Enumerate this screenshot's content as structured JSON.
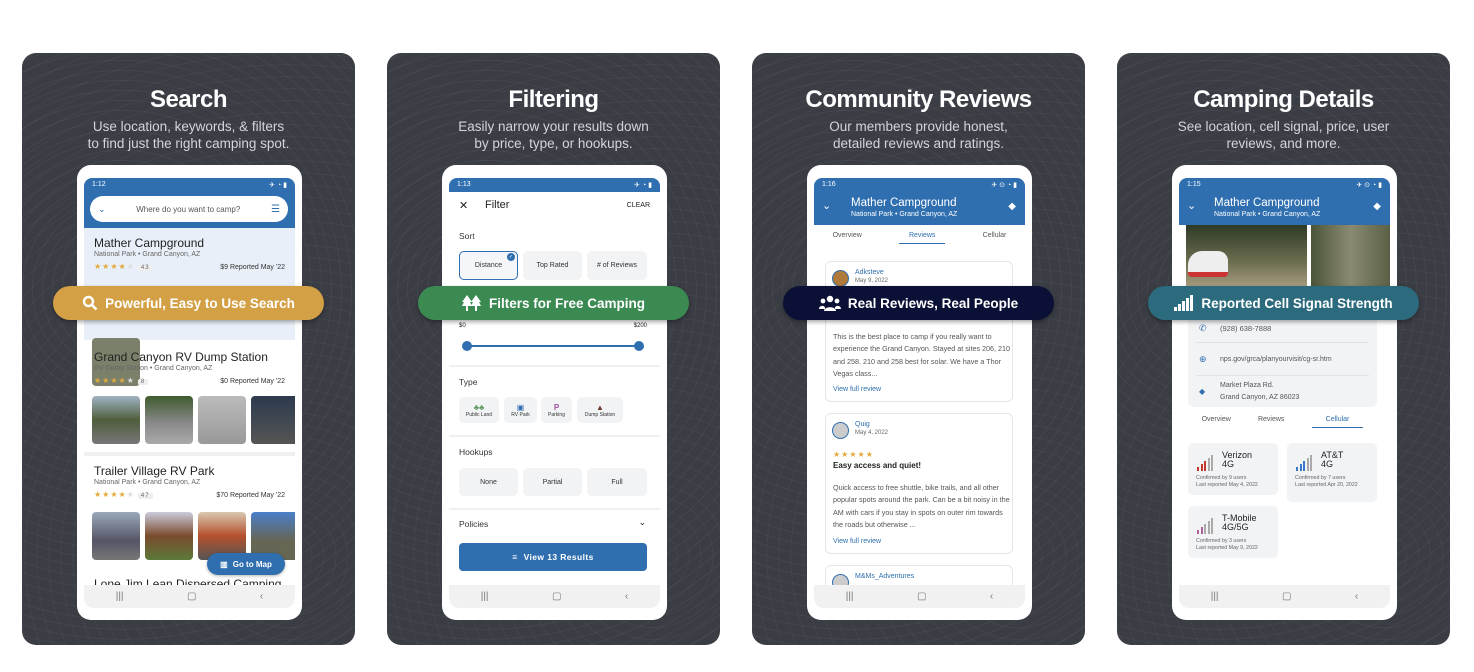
{
  "colors": {
    "panel_bg": "#3b3d45",
    "app_blue": "#2f6fb0",
    "search_banner": "#d4a046",
    "filter_banner": "#3b8a52",
    "reviews_banner": "#0b1136",
    "cell_banner": "#2c6b7d"
  },
  "panels": [
    {
      "title": "Search",
      "subtitle_lines": [
        "Use location, keywords, & filters",
        "to find just the right camping spot."
      ],
      "banner": {
        "label": "Powerful, Easy to Use Search",
        "icon": "search-icon"
      }
    },
    {
      "title": "Filtering",
      "subtitle_lines": [
        "Easily narrow your results down",
        "by price,  type, or hookups."
      ],
      "banner": {
        "label": "Filters for Free Camping",
        "icon": "trees-icon"
      }
    },
    {
      "title": "Community Reviews",
      "subtitle_lines": [
        "Our members provide honest,",
        "detailed reviews and ratings."
      ],
      "banner": {
        "label": "Real Reviews, Real People",
        "icon": "people-icon"
      }
    },
    {
      "title": "Camping Details",
      "subtitle_lines": [
        "See location, cell signal, price, user",
        "reviews, and more."
      ],
      "banner": {
        "label": "Reported Cell Signal Strength",
        "icon": "signal-icon"
      }
    }
  ],
  "search": {
    "time": "1:12",
    "placeholder": "Where do you want to camp?",
    "results": [
      {
        "name": "Mather Campground",
        "type": "National Park • Grand Canyon, AZ",
        "rating": 4,
        "reviews": "43",
        "price": "$9 Reported May '22"
      },
      {
        "name": "Grand Canyon RV Dump Station",
        "type": "RV Dump Station • Grand Canyon, AZ",
        "rating": 4,
        "reviews": "8",
        "price": "$0 Reported May '22"
      },
      {
        "name": "Trailer Village RV Park",
        "type": "National Park • Grand Canyon, AZ",
        "rating": 4,
        "reviews": "47",
        "price": "$70 Reported May '22"
      },
      {
        "name": "Lone Jim Lean Dispersed Camping"
      }
    ],
    "map_button": "Go to Map"
  },
  "filter": {
    "time": "1:13",
    "title": "Filter",
    "clear": "CLEAR",
    "sort_label": "Sort",
    "sort_options": [
      "Distance",
      "Top Rated",
      "# of Reviews"
    ],
    "sort_selected": "Distance",
    "price_min": "$0",
    "price_max": "$200",
    "type_label": "Type",
    "types": [
      "Public Land",
      "RV Park",
      "Parking",
      "Dump Station"
    ],
    "hookups_label": "Hookups",
    "hookups": [
      "None",
      "Partial",
      "Full"
    ],
    "policies_label": "Policies",
    "results_button": "View 13 Results"
  },
  "reviews": {
    "time": "1:16",
    "name": "Mather Campground",
    "subtitle": "National Park • Grand Canyon, AZ",
    "tabs": [
      "Overview",
      "Reviews",
      "Cellular"
    ],
    "active_tab": "Reviews",
    "items": [
      {
        "user": "Adksteve",
        "date": "May 9, 2022",
        "text": "This is the best place to camp if you really want to experience the Grand Canyon. Stayed at sites 206, 210 and 258. 210 and 258 best for solar. We have a Thor Vegas class...",
        "link": "View full review"
      },
      {
        "user": "Quig",
        "date": "May 4, 2022",
        "rating": 5,
        "heading": "Easy access and quiet!",
        "text": "Quick access to free shuttle, bike trails, and all other popular spots around the park. Can be a bit noisy in the AM with cars if you stay in spots on outer rim towards the roads but otherwise ...",
        "link": "View full review"
      },
      {
        "user": "M&Ms_Adventures"
      }
    ]
  },
  "details": {
    "time": "1:15",
    "name": "Mather Campground",
    "subtitle": "National Park • Grand Canyon, AZ",
    "phone": "(928) 638-7888",
    "website": "nps.gov/grca/planyourvisit/cg-sr.htm",
    "address_line1": "Market Plaza Rd.",
    "address_line2": "Grand Canyon, AZ 86023",
    "tabs": [
      "Overview",
      "Reviews",
      "Cellular"
    ],
    "active_tab": "Cellular",
    "carriers": [
      {
        "name": "Verizon",
        "tech": "4G",
        "confirmed": "Confirmed by 9 users",
        "last": "Last reported May 4, 2022",
        "signal_bars": 3,
        "color": "#c0392b"
      },
      {
        "name": "AT&T",
        "tech": "4G",
        "confirmed": "Confirmed by 7 users",
        "last": "Last reported Apr 20, 2022",
        "signal_bars": 3,
        "color": "#3a78c9"
      },
      {
        "name": "T-Mobile",
        "tech": "4G/5G",
        "confirmed": "Confirmed by 3 users",
        "last": "Last reported May 9, 2022",
        "signal_bars": 2,
        "color": "#b0609a"
      }
    ]
  }
}
